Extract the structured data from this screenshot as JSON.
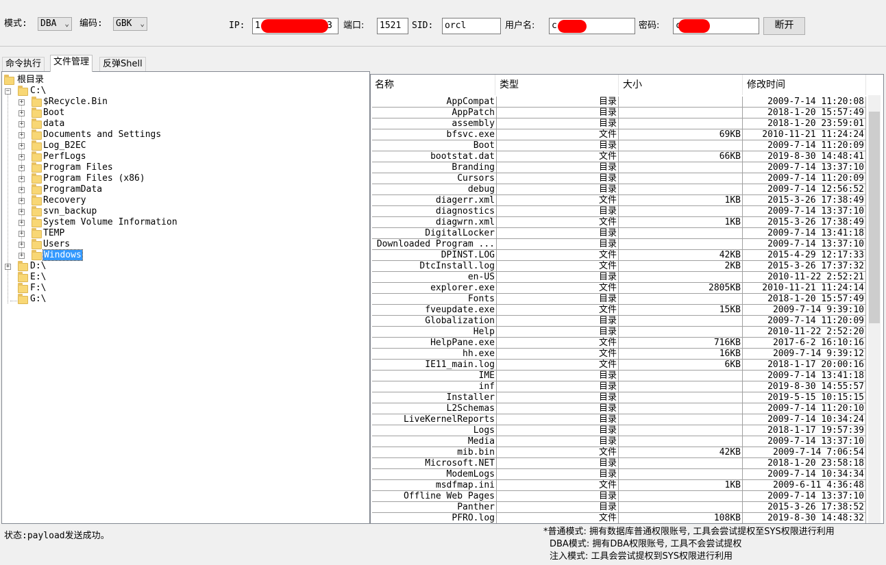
{
  "toolbar": {
    "mode_label": "模式:",
    "mode_value": "DBA",
    "encoding_label": "编码:",
    "encoding_value": "GBK",
    "ip_label": "IP:",
    "ip_value_start": "1",
    "ip_value_end": "3",
    "port_label": "端口:",
    "port_value": "1521",
    "sid_label": "SID:",
    "sid_value": "orcl",
    "username_label": "用户名:",
    "username_value": "c",
    "password_label": "密码:",
    "password_value": "c",
    "disconnect_label": "断开",
    "redaction_color": "#ff0000"
  },
  "tabs": [
    {
      "label": "命令执行",
      "active": false
    },
    {
      "label": "文件管理",
      "active": true
    },
    {
      "label": "反弹Shell",
      "active": false
    }
  ],
  "tree": {
    "root_label": "根目录",
    "drive_c": "C:\\",
    "c_children": [
      "$Recycle.Bin",
      "Boot",
      "data",
      "Documents and Settings",
      "Log_B2EC",
      "PerfLogs",
      "Program Files",
      "Program Files (x86)",
      "ProgramData",
      "Recovery",
      "svn_backup",
      "System Volume Information",
      "TEMP",
      "Users",
      "Windows"
    ],
    "selected": "Windows",
    "other_drives": [
      "D:\\",
      "E:\\",
      "F:\\",
      "G:\\"
    ]
  },
  "file_list": {
    "columns": [
      "名称",
      "类型",
      "大小",
      "修改时间"
    ],
    "rows": [
      [
        "AppCompat",
        "目录",
        "",
        "2009-7-14 11:20:08"
      ],
      [
        "AppPatch",
        "目录",
        "",
        "2018-1-20 15:57:49"
      ],
      [
        "assembly",
        "目录",
        "",
        "2018-1-20 23:59:01"
      ],
      [
        "bfsvc.exe",
        "文件",
        "69KB",
        "2010-11-21 11:24:24"
      ],
      [
        "Boot",
        "目录",
        "",
        "2009-7-14 11:20:09"
      ],
      [
        "bootstat.dat",
        "文件",
        "66KB",
        "2019-8-30 14:48:41"
      ],
      [
        "Branding",
        "目录",
        "",
        "2009-7-14 13:37:10"
      ],
      [
        "Cursors",
        "目录",
        "",
        "2009-7-14 11:20:09"
      ],
      [
        "debug",
        "目录",
        "",
        "2009-7-14 12:56:52"
      ],
      [
        "diagerr.xml",
        "文件",
        "1KB",
        "2015-3-26 17:38:49"
      ],
      [
        "diagnostics",
        "目录",
        "",
        "2009-7-14 13:37:10"
      ],
      [
        "diagwrn.xml",
        "文件",
        "1KB",
        "2015-3-26 17:38:49"
      ],
      [
        "DigitalLocker",
        "目录",
        "",
        "2009-7-14 13:41:18"
      ],
      [
        "Downloaded Program ...",
        "目录",
        "",
        "2009-7-14 13:37:10"
      ],
      [
        "DPINST.LOG",
        "文件",
        "42KB",
        "2015-4-29 12:17:33"
      ],
      [
        "DtcInstall.log",
        "文件",
        "2KB",
        "2015-3-26 17:37:32"
      ],
      [
        "en-US",
        "目录",
        "",
        "2010-11-22 2:52:21"
      ],
      [
        "explorer.exe",
        "文件",
        "2805KB",
        "2010-11-21 11:24:14"
      ],
      [
        "Fonts",
        "目录",
        "",
        "2018-1-20 15:57:49"
      ],
      [
        "fveupdate.exe",
        "文件",
        "15KB",
        "2009-7-14 9:39:10"
      ],
      [
        "Globalization",
        "目录",
        "",
        "2009-7-14 11:20:09"
      ],
      [
        "Help",
        "目录",
        "",
        "2010-11-22 2:52:20"
      ],
      [
        "HelpPane.exe",
        "文件",
        "716KB",
        "2017-6-2 16:10:16"
      ],
      [
        "hh.exe",
        "文件",
        "16KB",
        "2009-7-14 9:39:12"
      ],
      [
        "IE11_main.log",
        "文件",
        "6KB",
        "2018-1-17 20:00:16"
      ],
      [
        "IME",
        "目录",
        "",
        "2009-7-14 13:41:18"
      ],
      [
        "inf",
        "目录",
        "",
        "2019-8-30 14:55:57"
      ],
      [
        "Installer",
        "目录",
        "",
        "2019-5-15 10:15:15"
      ],
      [
        "L2Schemas",
        "目录",
        "",
        "2009-7-14 11:20:10"
      ],
      [
        "LiveKernelReports",
        "目录",
        "",
        "2009-7-14 10:34:24"
      ],
      [
        "Logs",
        "目录",
        "",
        "2018-1-17 19:57:39"
      ],
      [
        "Media",
        "目录",
        "",
        "2009-7-14 13:37:10"
      ],
      [
        "mib.bin",
        "文件",
        "42KB",
        "2009-7-14 7:06:54"
      ],
      [
        "Microsoft.NET",
        "目录",
        "",
        "2018-1-20 23:58:18"
      ],
      [
        "ModemLogs",
        "目录",
        "",
        "2009-7-14 10:34:34"
      ],
      [
        "msdfmap.ini",
        "文件",
        "1KB",
        "2009-6-11 4:36:48"
      ],
      [
        "Offline Web Pages",
        "目录",
        "",
        "2009-7-14 13:37:10"
      ],
      [
        "Panther",
        "目录",
        "",
        "2015-3-26 17:38:52"
      ],
      [
        "PFRO.log",
        "文件",
        "108KB",
        "2019-8-30 14:48:32"
      ]
    ]
  },
  "status_text": "状态:payload发送成功。",
  "notes": [
    "*普通模式: 拥有数据库普通权限账号, 工具会尝试提权至SYS权限进行利用",
    "DBA模式: 拥有DBA权限账号, 工具不会尝试提权",
    "注入模式: 工具会尝试提权到SYS权限进行利用"
  ]
}
